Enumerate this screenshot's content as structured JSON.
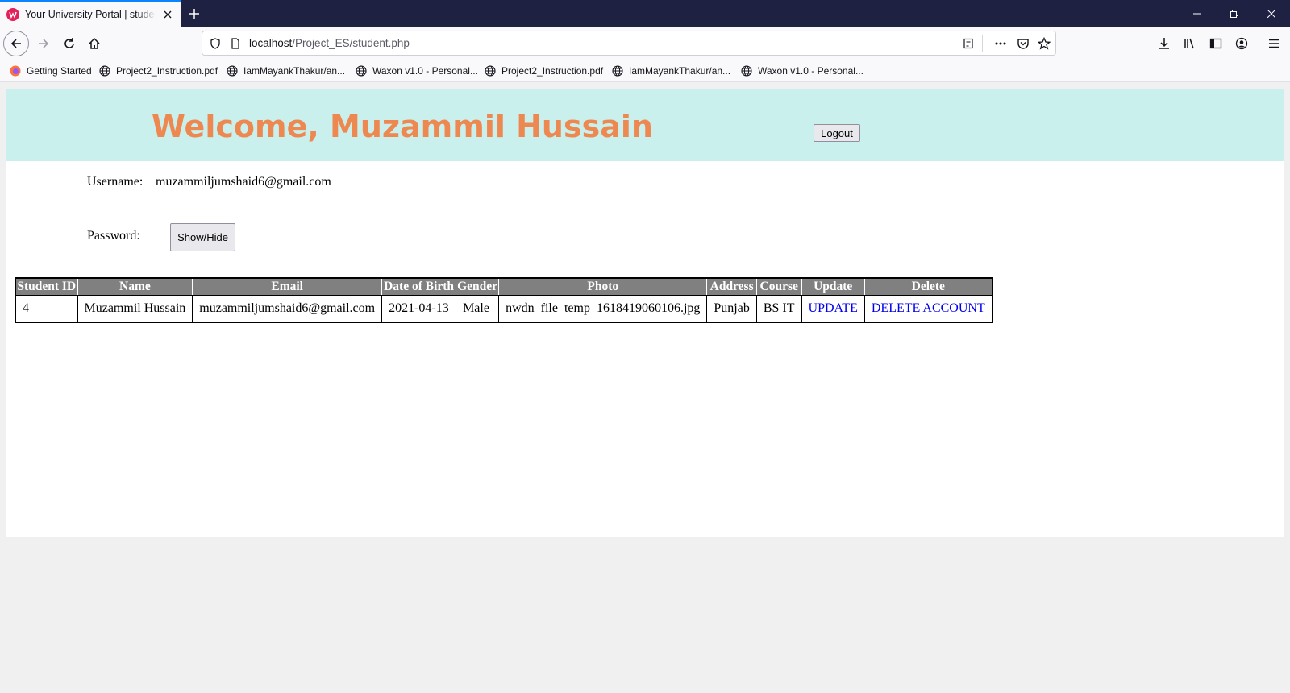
{
  "browser": {
    "tab_title": "Your University Portal | student",
    "url_host": "localhost",
    "url_path": "/Project_ES/student.php",
    "bookmarks": [
      {
        "label": "Getting Started",
        "icon": "firefox-icon"
      },
      {
        "label": "Project2_Instruction.pdf",
        "icon": "globe-icon"
      },
      {
        "label": "IamMayankThakur/an...",
        "icon": "globe-icon"
      },
      {
        "label": "Waxon v1.0 - Personal...",
        "icon": "globe-icon"
      },
      {
        "label": "Project2_Instruction.pdf",
        "icon": "globe-icon"
      },
      {
        "label": "IamMayankThakur/an...",
        "icon": "globe-icon"
      },
      {
        "label": "Waxon v1.0 - Personal...",
        "icon": "globe-icon"
      }
    ]
  },
  "header": {
    "welcome": "Welcome, Muzammil Hussain",
    "logout_label": "Logout"
  },
  "account": {
    "username_label": "Username:",
    "username_value": "muzammiljumshaid6@gmail.com",
    "password_label": "Password:",
    "showhide_label": "Show/Hide"
  },
  "table": {
    "headers": [
      "Student ID",
      "Name",
      "Email",
      "Date of Birth",
      "Gender",
      "Photo",
      "Address",
      "Course",
      "Update",
      "Delete"
    ],
    "rows": [
      {
        "id": "4",
        "name": "Muzammil Hussain",
        "email": "muzammiljumshaid6@gmail.com",
        "dob": "2021-04-13",
        "gender": "Male",
        "photo": "nwdn_file_temp_1618419060106.jpg",
        "address": "Punjab",
        "course": "BS IT",
        "update": "UPDATE",
        "delete": "DELETE ACCOUNT"
      }
    ]
  },
  "colors": {
    "header_band": "#c9f0ec",
    "welcome_text": "#ee8851",
    "table_header": "#808080",
    "link": "#0000ee"
  }
}
